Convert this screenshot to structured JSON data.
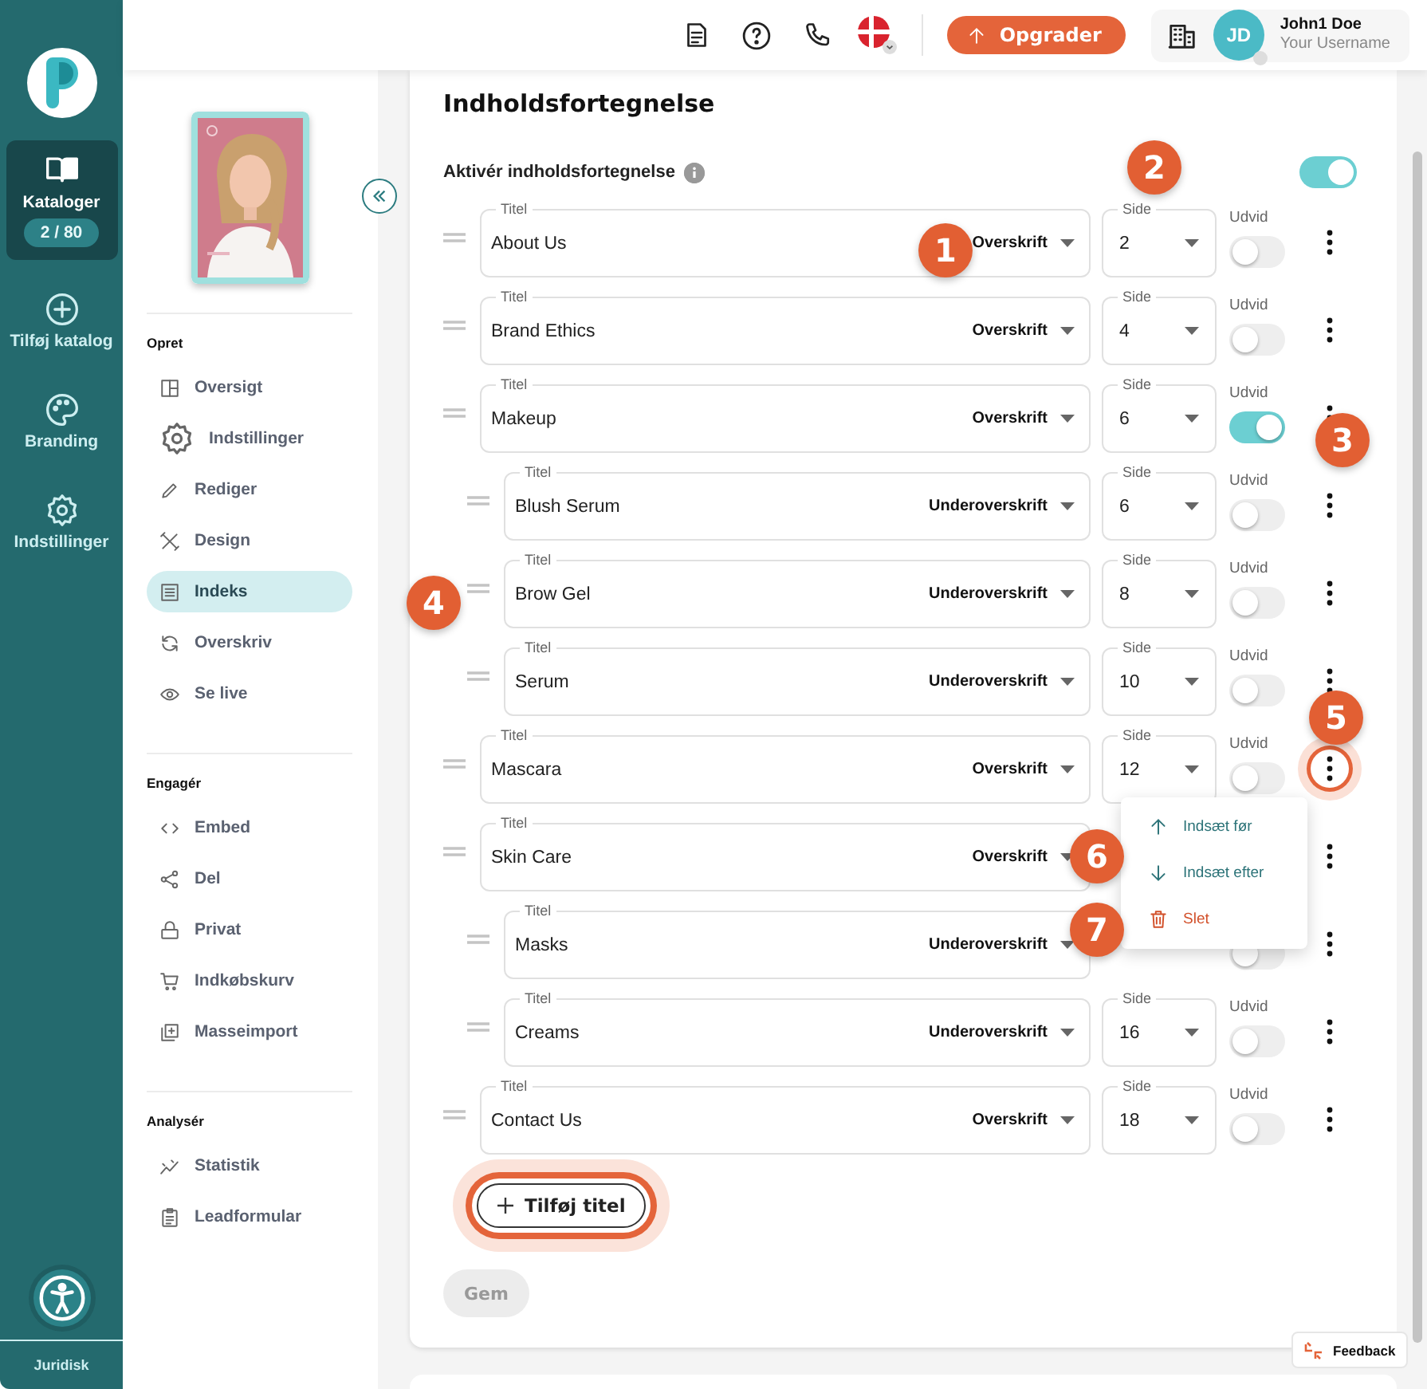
{
  "rail": {
    "items": [
      {
        "label": "Kataloger",
        "badge": "2 / 80",
        "selected": true
      },
      {
        "label": "Tilføj katalog",
        "selected": false
      },
      {
        "label": "Branding",
        "selected": false
      },
      {
        "label": "Indstillinger",
        "selected": false
      }
    ],
    "footer": "Juridisk"
  },
  "topbar": {
    "upgrade_button": "Opgrader",
    "user": {
      "initials": "JD",
      "name": "John1 Doe",
      "username": "Your Username"
    }
  },
  "sidebar": {
    "sections": [
      {
        "title": "Opret",
        "items": [
          {
            "label": "Oversigt",
            "selected": false
          },
          {
            "label": "Indstillinger",
            "selected": false
          },
          {
            "label": "Rediger",
            "selected": false
          },
          {
            "label": "Design",
            "selected": false
          },
          {
            "label": "Indeks",
            "selected": true
          },
          {
            "label": "Overskriv",
            "selected": false
          },
          {
            "label": "Se live",
            "selected": false
          }
        ]
      },
      {
        "title": "Engagér",
        "items": [
          {
            "label": "Embed",
            "selected": false
          },
          {
            "label": "Del",
            "selected": false
          },
          {
            "label": "Privat",
            "selected": false
          },
          {
            "label": "Indkøbskurv",
            "selected": false
          },
          {
            "label": "Masseimport",
            "selected": false
          }
        ]
      },
      {
        "title": "Analysér",
        "items": [
          {
            "label": "Statistik",
            "selected": false
          },
          {
            "label": "Leadformular",
            "selected": false
          }
        ]
      }
    ]
  },
  "panel": {
    "title": "Indholdsfortegnelse",
    "enable_label": "Aktivér indholdsfortegnelse",
    "enabled": true,
    "entries": [
      {
        "kind": "heading",
        "title_label": "Titel",
        "title": "About Us",
        "type": "Overskrift",
        "page_label": "Side",
        "page": "2",
        "expand_label": "Udvid",
        "expanded": false,
        "menu_open": false
      },
      {
        "kind": "heading",
        "title_label": "Titel",
        "title": "Brand Ethics",
        "type": "Overskrift",
        "page_label": "Side",
        "page": "4",
        "expand_label": "Udvid",
        "expanded": false,
        "menu_open": false
      },
      {
        "kind": "heading",
        "title_label": "Titel",
        "title": "Makeup",
        "type": "Overskrift",
        "page_label": "Side",
        "page": "6",
        "expand_label": "Udvid",
        "expanded": true,
        "menu_open": false
      },
      {
        "kind": "subheading",
        "title_label": "Titel",
        "title": "Blush Serum",
        "type": "Underoverskrift",
        "page_label": "Side",
        "page": "6",
        "expand_label": "Udvid",
        "expanded": false,
        "menu_open": false
      },
      {
        "kind": "subheading",
        "title_label": "Titel",
        "title": "Brow Gel",
        "type": "Underoverskrift",
        "page_label": "Side",
        "page": "8",
        "expand_label": "Udvid",
        "expanded": false,
        "menu_open": false
      },
      {
        "kind": "subheading",
        "title_label": "Titel",
        "title": "Serum",
        "type": "Underoverskrift",
        "page_label": "Side",
        "page": "10",
        "expand_label": "Udvid",
        "expanded": false,
        "menu_open": false
      },
      {
        "kind": "heading",
        "title_label": "Titel",
        "title": "Mascara",
        "type": "Overskrift",
        "page_label": "Side",
        "page": "12",
        "expand_label": "Udvid",
        "expanded": false,
        "menu_open": true
      },
      {
        "kind": "heading",
        "title_label": "Titel",
        "title": "Skin Care",
        "type": "Overskrift",
        "menu_open": false
      },
      {
        "kind": "subheading",
        "title_label": "Titel",
        "title": "Masks",
        "type": "Underoverskrift",
        "expanded": false,
        "menu_open": false
      },
      {
        "kind": "subheading",
        "title_label": "Titel",
        "title": "Creams",
        "type": "Underoverskrift",
        "page_label": "Side",
        "page": "16",
        "expand_label": "Udvid",
        "expanded": false,
        "menu_open": false
      },
      {
        "kind": "heading",
        "title_label": "Titel",
        "title": "Contact Us",
        "type": "Overskrift",
        "page_label": "Side",
        "page": "18",
        "expand_label": "Udvid",
        "expanded": false,
        "menu_open": false
      }
    ],
    "add_button": {
      "label": "Tilføj titel",
      "highlighted": true
    },
    "save_button": {
      "label": "Gem",
      "disabled": true
    }
  },
  "menu": {
    "items": [
      {
        "label": "Indsæt før",
        "kind": "insert-before"
      },
      {
        "label": "Indsæt efter",
        "kind": "insert-after"
      },
      {
        "label": "Slet",
        "kind": "delete"
      }
    ]
  },
  "callouts": [
    "1",
    "2",
    "3",
    "4",
    "5",
    "6",
    "7"
  ],
  "feedback": "Feedback"
}
